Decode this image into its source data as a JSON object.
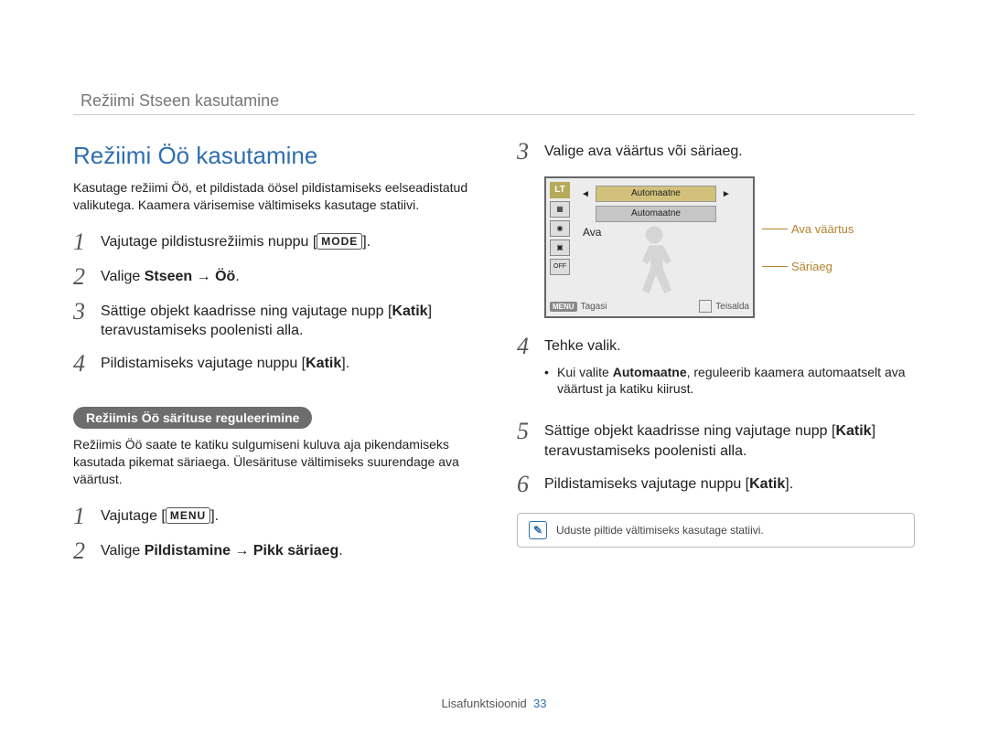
{
  "running_head": "Režiimi Stseen kasutamine",
  "section_title": "Režiimi Öö kasutamine",
  "intro": "Kasutage režiimi Öö, et pildistada öösel pildistamiseks eelseadistatud valikutega. Kaamera värisemise vältimiseks kasutage statiivi.",
  "left": {
    "steps": {
      "s1a": "Vajutage pildistusrežiimis nuppu [",
      "s1btn": "MODE",
      "s1b": "].",
      "s2a": "Valige ",
      "s2bold": "Stseen → Öö",
      "s2b": ".",
      "s3a": "Sättige objekt kaadrisse ning vajutage nupp [",
      "s3bold": "Katik",
      "s3b": "] teravustamiseks poolenisti alla.",
      "s4a": "Pildistamiseks vajutage nuppu [",
      "s4bold": "Katik",
      "s4b": "]."
    },
    "pill": "Režiimis Öö särituse reguleerimine",
    "subintro": "Režiimis Öö saate te katiku sulgumiseni kuluva aja pikendamiseks kasutada pikemat säriaega. Ülesärituse vältimiseks suurendage ava väärtust.",
    "substeps": {
      "s1a": "Vajutage [",
      "s1btn": "MENU",
      "s1b": "].",
      "s2a": "Valige ",
      "s2bold": "Pildistamine → Pikk säriaeg",
      "s2b": "."
    }
  },
  "right": {
    "step3": "Valige ava väärtus või säriaeg.",
    "fig": {
      "lt": "LT",
      "box1": "Automaatne",
      "box2": "Automaatne",
      "ava": "Ava",
      "menu_chip": "MENU",
      "tagasi": "Tagasi",
      "teisalda": "Teisalda",
      "call1": "Ava väärtus",
      "call2": "Säriaeg"
    },
    "step4": "Tehke valik.",
    "step4_bullet_a": "Kui valite ",
    "step4_bullet_bold": "Automaatne",
    "step4_bullet_b": ", reguleerib kaamera automaatselt ava väärtust ja katiku kiirust.",
    "step5a": "Sättige objekt kaadrisse ning vajutage nupp [",
    "step5bold": "Katik",
    "step5b": "] teravustamiseks poolenisti alla.",
    "step6a": "Pildistamiseks vajutage nuppu [",
    "step6bold": "Katik",
    "step6b": "].",
    "tip": "Uduste piltide vältimiseks kasutage statiivi."
  },
  "footer_label": "Lisafunktsioonid",
  "footer_page": "33"
}
